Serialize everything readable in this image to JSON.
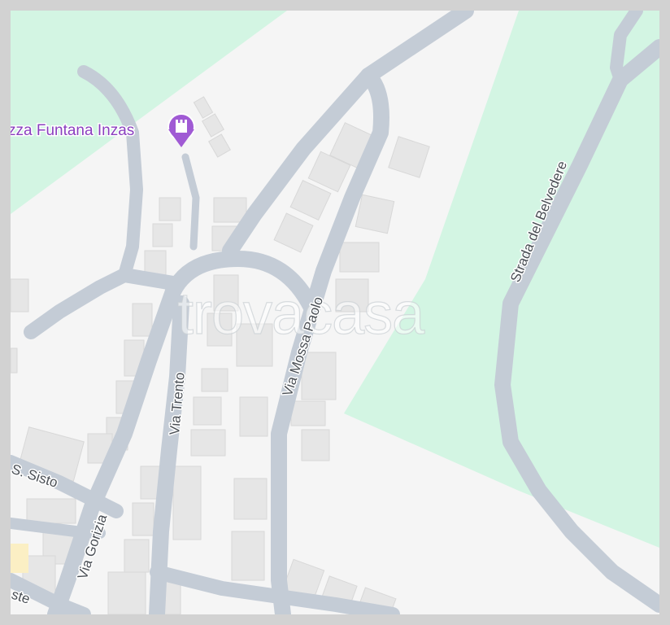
{
  "map": {
    "watermark": "trovacasa",
    "poi": {
      "label": "zza Funtana Inzas",
      "icon": "castle-icon",
      "color": "#a05ad4"
    },
    "streets": {
      "via_mossa_paolo": "Via Mossa Paolo",
      "via_trento": "Via Trento",
      "via_gorizia": "Via Gorizia",
      "strada_del_belvedere": "Strada del Belvedere",
      "s_sisto": "S. Sisto",
      "partial_bottom_left": "ste"
    },
    "colors": {
      "background": "#f5f5f5",
      "park": "#d3f5e3",
      "road": "#c4ccd6",
      "building": "#e6e6e6",
      "building_outline": "#d8d8d8",
      "frame": "#d2d2d2"
    }
  }
}
